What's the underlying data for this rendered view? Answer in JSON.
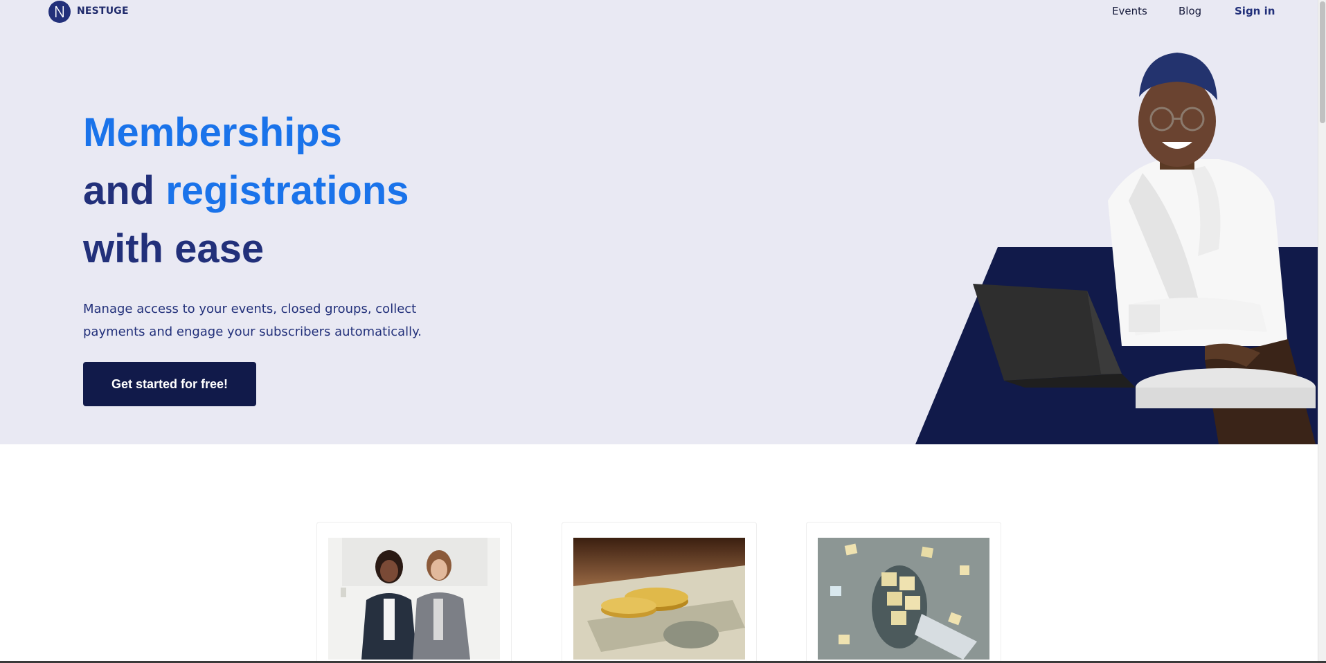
{
  "nav": {
    "brand": "NESTUGE",
    "links": [
      {
        "label": "Events"
      },
      {
        "label": "Blog"
      },
      {
        "label": "Sign in"
      }
    ]
  },
  "hero": {
    "headline": {
      "line1": {
        "blue": "Memberships"
      },
      "line2": {
        "navy": "and ",
        "blue": "registrations"
      },
      "line3": {
        "navy": "with ease"
      }
    },
    "subtext": {
      "line1": "Manage access to your events, closed groups, collect",
      "line2": "payments and engage your subscribers automatically."
    },
    "cta_label": "Get started for free!"
  },
  "colors": {
    "hero_bg": "#e9e9f3",
    "navy": "#22307a",
    "blue": "#1a73ea",
    "cta_bg": "#111a4a"
  },
  "icons": {
    "logo": "nestuge-logo-icon"
  }
}
